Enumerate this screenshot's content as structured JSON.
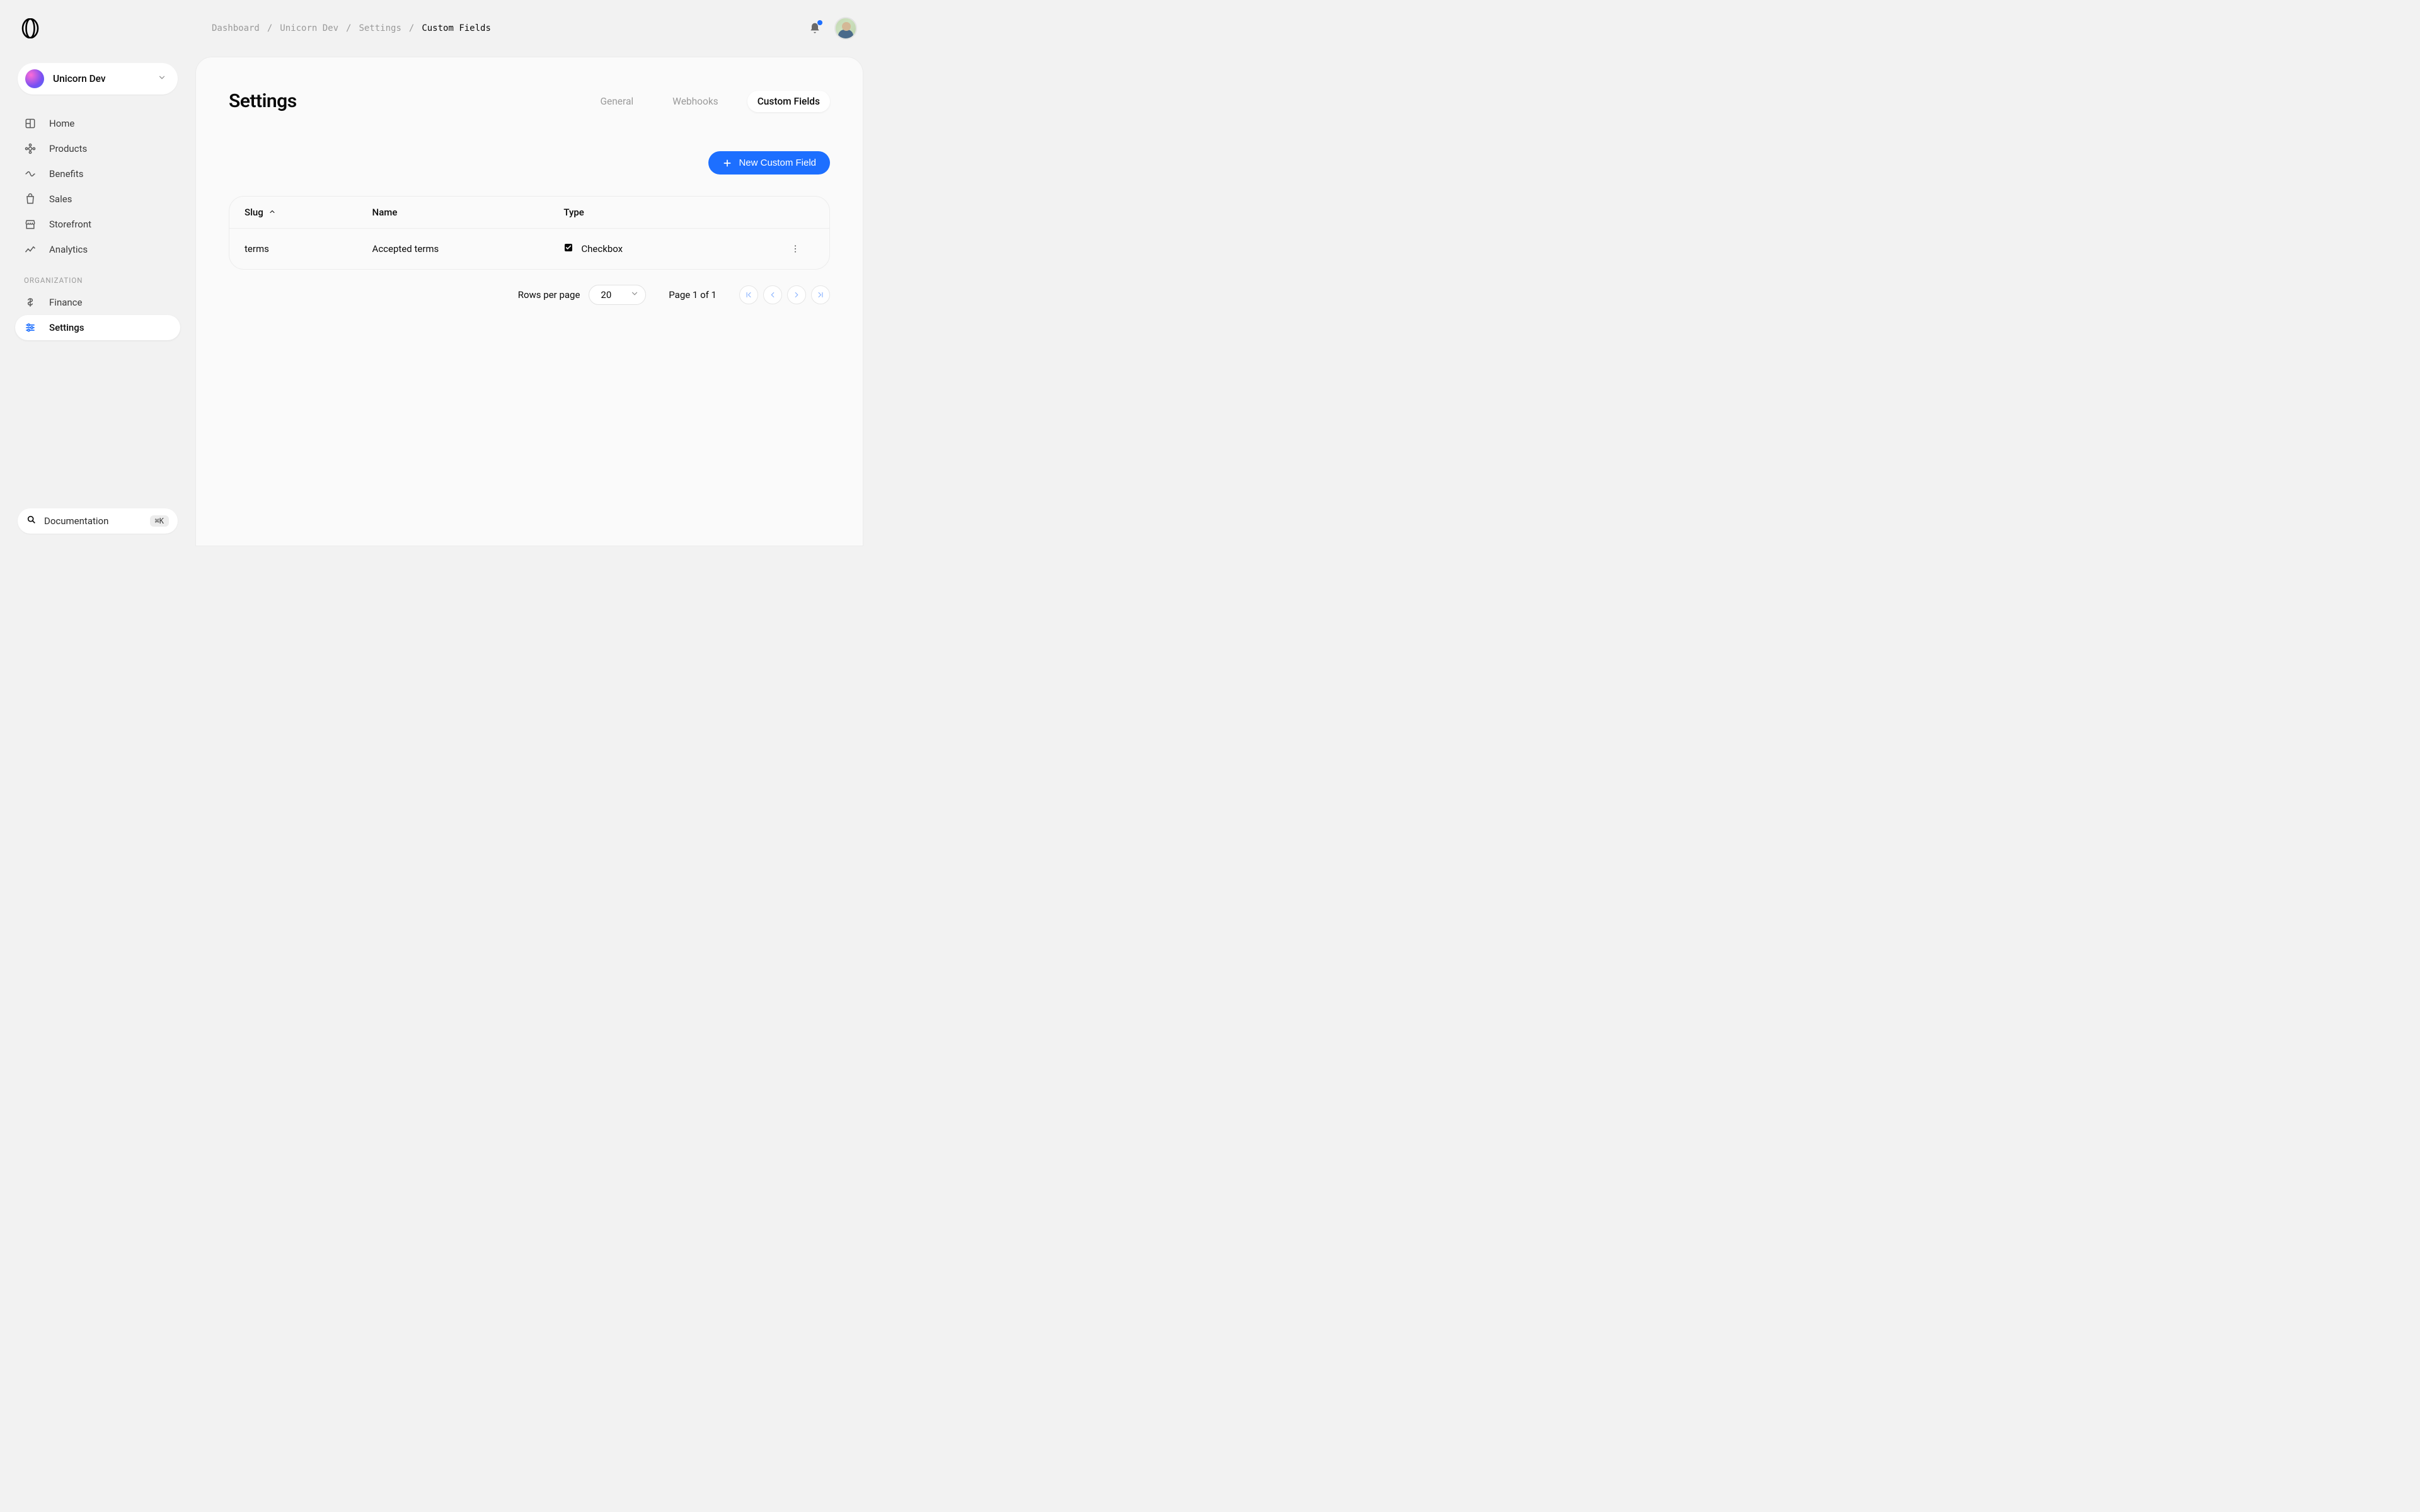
{
  "breadcrumb": {
    "items": [
      "Dashboard",
      "Unicorn Dev",
      "Settings",
      "Custom Fields"
    ],
    "separator": "/"
  },
  "org": {
    "name": "Unicorn Dev"
  },
  "sidebar": {
    "items": [
      {
        "label": "Home"
      },
      {
        "label": "Products"
      },
      {
        "label": "Benefits"
      },
      {
        "label": "Sales"
      },
      {
        "label": "Storefront"
      },
      {
        "label": "Analytics"
      }
    ],
    "section_label": "ORGANIZATION",
    "org_items": [
      {
        "label": "Finance"
      },
      {
        "label": "Settings"
      }
    ]
  },
  "doc_pill": {
    "label": "Documentation",
    "shortcut": "⌘K"
  },
  "page": {
    "title": "Settings"
  },
  "tabs": [
    {
      "label": "General"
    },
    {
      "label": "Webhooks"
    },
    {
      "label": "Custom Fields"
    }
  ],
  "actions": {
    "new_custom_field": "New Custom Field"
  },
  "table": {
    "columns": {
      "slug": "Slug",
      "name": "Name",
      "type": "Type"
    },
    "rows": [
      {
        "slug": "terms",
        "name": "Accepted terms",
        "type": "Checkbox"
      }
    ]
  },
  "pagination": {
    "rows_per_page_label": "Rows per page",
    "rows_per_page_value": "20",
    "page_info": "Page 1 of 1"
  }
}
